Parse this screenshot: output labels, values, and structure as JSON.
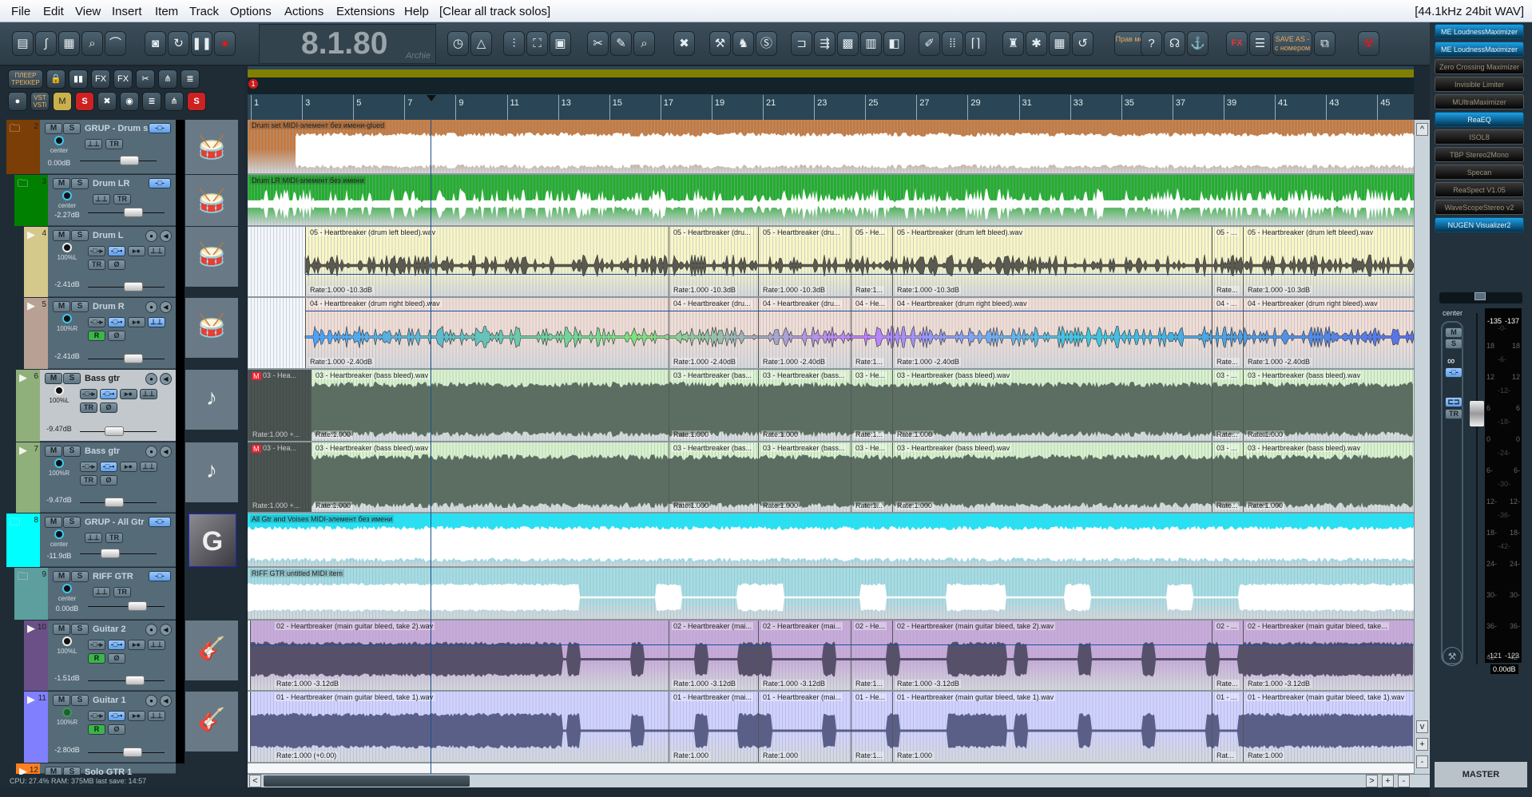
{
  "menu": {
    "items": [
      "File",
      "Edit",
      "View",
      "Insert",
      "Item",
      "Track",
      "Options",
      "Actions",
      "Extensions",
      "Help"
    ],
    "action_hint": "[Clear all track solos]",
    "format_info": "[44.1kHz 24bit WAV]"
  },
  "toolbar": {
    "time_display": "8.1.80",
    "time_user": "Archie",
    "buttons": [
      {
        "icon": "film-icon"
      },
      {
        "icon": "envelope-icon"
      },
      {
        "icon": "color-palette-icon"
      },
      {
        "icon": "find-icon"
      },
      {
        "icon": "curve-icon"
      },
      {
        "icon": "drum-icon"
      },
      {
        "icon": "loop-icon"
      },
      {
        "icon": "pause-icon"
      },
      {
        "icon": "record-icon"
      },
      {
        "icon": "metronome-clock-icon"
      },
      {
        "icon": "metronome-icon"
      },
      {
        "icon": "mixer-icon"
      },
      {
        "icon": "fullscreen-icon"
      },
      {
        "icon": "screen-capture-icon"
      },
      {
        "icon": "split-item-icon"
      },
      {
        "icon": "pencil-icon"
      },
      {
        "icon": "zoom-icon"
      },
      {
        "icon": "delete-track-icon"
      },
      {
        "icon": "wrench-icon"
      },
      {
        "icon": "walkers-icon"
      },
      {
        "icon": "sws-icon"
      },
      {
        "icon": "snap-icon"
      },
      {
        "icon": "ripple-icon"
      },
      {
        "icon": "grid-snap-icon"
      },
      {
        "icon": "color-tracks-icon"
      },
      {
        "icon": "toggle-icon"
      },
      {
        "icon": "brush-icon"
      },
      {
        "icon": "dots-grid-icon"
      },
      {
        "icon": "bracket-icon"
      },
      {
        "icon": "cleanup-icon"
      },
      {
        "icon": "new-folder-icon"
      },
      {
        "icon": "table-icon"
      },
      {
        "icon": "undo-disk-icon"
      },
      {
        "icon": "text-button",
        "label": "Прав меня"
      },
      {
        "icon": "help-icon"
      },
      {
        "icon": "headphones-icon"
      },
      {
        "icon": "anchor-icon"
      },
      {
        "icon": "fx-bypass-icon",
        "label": "FX"
      },
      {
        "icon": "list-icon"
      },
      {
        "icon": "text-button",
        "label": "SAVE AS - с номером"
      },
      {
        "icon": "copy-files-icon"
      },
      {
        "icon": "radiation-icon"
      }
    ]
  },
  "left_toolbar": {
    "row1": [
      {
        "icon": "text-button",
        "label": "ПЛЕЕР ТРЕККЕР"
      },
      {
        "icon": "lock-icon"
      },
      {
        "icon": "show-meters-icon"
      },
      {
        "icon": "fx-remove-icon",
        "label": "FX"
      },
      {
        "icon": "fx-show-icon",
        "label": "FX"
      },
      {
        "icon": "trim-icon"
      },
      {
        "icon": "routing-icon"
      },
      {
        "icon": "track-height-icon"
      }
    ],
    "row2": [
      {
        "icon": "record-circle-icon"
      },
      {
        "icon": "text-button",
        "label": "VST VSTi"
      },
      {
        "icon": "mute-all-icon",
        "label": "M"
      },
      {
        "icon": "solo-all-icon",
        "label": "S"
      },
      {
        "icon": "env-remove-icon"
      },
      {
        "icon": "env-show-icon"
      },
      {
        "icon": "rec-list-icon"
      },
      {
        "icon": "route-tree-icon"
      },
      {
        "icon": "solo-red-icon",
        "label": "S"
      }
    ]
  },
  "ruler": {
    "bars": [
      "1",
      "3",
      "5",
      "7",
      "9",
      "11",
      "13",
      "15",
      "17",
      "19",
      "21",
      "23",
      "25",
      "27",
      "29",
      "31",
      "33",
      "35",
      "37",
      "39",
      "41",
      "43",
      "45"
    ],
    "marker": "1"
  },
  "tracks": [
    {
      "num": "2",
      "name": "GRUP - Drum s",
      "folder": true,
      "pan": "center",
      "vol": "0.00dB",
      "color": "#7a3e06",
      "lane": "#c67a3e",
      "wave": "#ffffff",
      "style": "dense",
      "thumb": "drum-kit-image",
      "items": [
        {
          "label": "Drum set MIDI-элемент без имени-glued",
          "rate": ""
        }
      ]
    },
    {
      "num": "3",
      "name": "Drum LR",
      "folder": true,
      "pan": "center",
      "vol": "-2.27dB",
      "color": "#008000",
      "lane": "#24ad2c",
      "wave": "#ffffff",
      "style": "spiky-white",
      "thumb": "drum-kit-image",
      "items": [
        {
          "label": "Drum LR MIDI-элемент без имени",
          "rate": ""
        }
      ]
    },
    {
      "num": "4",
      "name": "Drum L",
      "pan": "100%L",
      "vol": "-2.41dB",
      "color": "#d4c98a",
      "lane": "#faf6c4",
      "wave": "#5a5a50",
      "style": "spiky",
      "thumb": "drum-kit-image",
      "rec": false,
      "items": [
        {
          "label": "05 - Heartbreaker (drum left bleed).wav",
          "rate": "Rate:1.000 -10.3dB"
        },
        {
          "label": "05 - Heartbreaker (dru...",
          "rate": "Rate:1.000 -10.3dB"
        },
        {
          "label": "05 - Heartbreaker (dru...",
          "rate": "Rate:1.000 -10.3dB"
        },
        {
          "label": "05 - He...",
          "rate": "Rate:1..."
        },
        {
          "label": "05 - Heartbreaker (drum left bleed).wav",
          "rate": "Rate:1.000 -10.3dB"
        },
        {
          "label": "05 - ...",
          "rate": "Rate..."
        },
        {
          "label": "05 - Heartbreaker (drum left bleed).wav",
          "rate": "Rate:1.000 -10.3dB"
        }
      ]
    },
    {
      "num": "5",
      "name": "Drum R",
      "pan": "100%R",
      "vol": "-2.41dB",
      "color": "#b8a194",
      "lane": "#f2ddd3",
      "wave": "#4a78d8",
      "style": "spiky-color",
      "thumb": "drum-kit-image",
      "rec": true,
      "items": [
        {
          "label": "04 - Heartbreaker (drum right bleed).wav",
          "rate": "Rate:1.000 -2.40dB"
        },
        {
          "label": "04 - Heartbreaker (dru...",
          "rate": "Rate:1.000 -2.40dB"
        },
        {
          "label": "04 - Heartbreaker (dru...",
          "rate": "Rate:1.000 -2.40dB"
        },
        {
          "label": "04 - He...",
          "rate": "Rate:1..."
        },
        {
          "label": "04 - Heartbreaker (drum right bleed).wav",
          "rate": "Rate:1.000 -2.40dB"
        },
        {
          "label": "04 - ...",
          "rate": "Rate..."
        },
        {
          "label": "04 - Heartbreaker (drum right bleed).wav",
          "rate": "Rate:1.000 -2.40dB"
        }
      ]
    },
    {
      "num": "6",
      "name": "Bass gtr",
      "pan": "100%L",
      "vol": "-9.47dB",
      "color": "#8fb07a",
      "lane": "#d9f2c9",
      "wave": "#5c6e62",
      "style": "bass",
      "thumb": "bass-guitar-image",
      "rec": false,
      "selected": true,
      "pre_item": {
        "badge": "M",
        "label": "03 - Hea...",
        "rate": "Rate:1.000 +..."
      },
      "items": [
        {
          "label": "03 - Heartbreaker (bass bleed).wav",
          "rate": "Rate:1.000"
        },
        {
          "label": "03 - Heartbreaker (bas...",
          "rate": "Rate:1.000"
        },
        {
          "label": "03 - Heartbreaker (bass...",
          "rate": "Rate:1.000"
        },
        {
          "label": "03 - He...",
          "rate": "Rate:1..."
        },
        {
          "label": "03 - Heartbreaker (bass bleed).wav",
          "rate": "Rate:1.000"
        },
        {
          "label": "03 - ...",
          "rate": "Rate..."
        },
        {
          "label": "03 - Heartbreaker (bass bleed).wav",
          "rate": "Rate:1.000"
        }
      ]
    },
    {
      "num": "7",
      "name": "Bass gtr",
      "pan": "100%R",
      "vol": "-9.47dB",
      "color": "#8fb07a",
      "lane": "#d9f2c9",
      "wave": "#5c6e62",
      "style": "bass",
      "thumb": "bass-guitar-image",
      "rec": false,
      "pre_item": {
        "badge": "M",
        "label": "03 - Hea...",
        "rate": "Rate:1.000 +..."
      },
      "items": [
        {
          "label": "03 - Heartbreaker (bass bleed).wav",
          "rate": "Rate:1.000"
        },
        {
          "label": "03 - Heartbreaker (bas...",
          "rate": "Rate:1.000"
        },
        {
          "label": "03 - Heartbreaker (bass...",
          "rate": "Rate:1.000"
        },
        {
          "label": "03 - He...",
          "rate": "Rate:1..."
        },
        {
          "label": "03 - Heartbreaker (bass bleed).wav",
          "rate": "Rate:1.000"
        },
        {
          "label": "03 - ...",
          "rate": "Rate..."
        },
        {
          "label": "03 - Heartbreaker (bass bleed).wav",
          "rate": "Rate:1.000"
        }
      ]
    },
    {
      "num": "8",
      "name": "GRUP - All Gtr",
      "folder": true,
      "pan": "center",
      "vol": "-11.9dB",
      "color": "#00ffff",
      "lane": "#1ee6f6",
      "wave": "#ffffff",
      "style": "dense",
      "thumb": "G",
      "items": [
        {
          "label": "All Gtr and Voises MIDI-элемент без имени",
          "rate": ""
        }
      ]
    },
    {
      "num": "9",
      "name": "RIFF GTR",
      "folder": true,
      "pan": "center",
      "vol": "0.00dB",
      "color": "#5d9e9e",
      "lane": "#a4dde2",
      "wave": "#ffffff",
      "style": "gappy-white",
      "thumb": "",
      "items": [
        {
          "label": "RIFF GTR untitled MIDI item",
          "rate": ""
        }
      ]
    },
    {
      "num": "10",
      "name": "Guitar 2",
      "pan": "100%L",
      "vol": "-1.51dB",
      "color": "#6b5088",
      "lane": "#caa9d9",
      "wave": "#57506a",
      "style": "guitar",
      "thumb": "electric-guitar-image",
      "rec": true,
      "items": [
        {
          "label": "02 - Heartbreaker (main guitar bleed, take 2).wav",
          "rate": "Rate:1.000 -3.12dB"
        },
        {
          "label": "02 - Heartbreaker (mai...",
          "rate": "Rate:1.000 -3.12dB"
        },
        {
          "label": "02 - Heartbreaker (mai...",
          "rate": "Rate:1.000 -3.12dB"
        },
        {
          "label": "02 - He...",
          "rate": "Rate:1..."
        },
        {
          "label": "02 - Heartbreaker (main guitar bleed, take 2).wav",
          "rate": "Rate:1.000 -3.12dB"
        },
        {
          "label": "02 - ...",
          "rate": "Rate..."
        },
        {
          "label": "02 - Heartbreaker (main guitar bleed, take...",
          "rate": "Rate:1.000 -3.12dB"
        }
      ]
    },
    {
      "num": "11",
      "name": "Guitar 1",
      "pan": "100%R",
      "vol": "-2.80dB",
      "color": "#8080ff",
      "lane": "#d2d2ff",
      "wave": "#5a5f88",
      "style": "guitar",
      "thumb": "les-paul-guitar-image",
      "rec": true,
      "items": [
        {
          "label": "01 - Heartbreaker (main guitar bleed, take 1).wav",
          "rate": "Rate:1.000 (+0.00)"
        },
        {
          "label": "01 - Heartbreaker (mai...",
          "rate": "Rate:1.000"
        },
        {
          "label": "01 - Heartbreaker (mai...",
          "rate": "Rate:1.000"
        },
        {
          "label": "01 - He...",
          "rate": "Rate:1..."
        },
        {
          "label": "01 - Heartbreaker (main guitar bleed, take 1).wav",
          "rate": "Rate:1.000"
        },
        {
          "label": "01 - ...",
          "rate": "Rat..."
        },
        {
          "label": "01 - Heartbreaker (main guitar bleed, take 1).wav",
          "rate": "Rate:1.000"
        }
      ]
    },
    {
      "num": "12",
      "name": "Solo GTR 1",
      "pan": "",
      "vol": "",
      "color": "#ff7f1e",
      "lane": "#f4f6f8",
      "wave": "#888",
      "style": "none",
      "thumb": "",
      "items": []
    }
  ],
  "status": "CPU: 27.4%  RAM: 375MB  last save: 14:57",
  "fx_chain": [
    {
      "name": "ME LoudnessMaximizer",
      "active": true
    },
    {
      "name": "ME LoudnessMaximizer",
      "active": true
    },
    {
      "name": "Zero Crossing Maximizer",
      "active": false
    },
    {
      "name": "Invisible Limiter",
      "active": false
    },
    {
      "name": "MUltraMaximizer",
      "active": false
    },
    {
      "name": "ReaEQ",
      "active": true
    },
    {
      "name": "ISOL8",
      "active": false
    },
    {
      "name": "TBP Stereo2Mono",
      "active": false
    },
    {
      "name": "Specan",
      "active": false
    },
    {
      "name": "ReaSpect V1.05",
      "active": false
    },
    {
      "name": "WaveScopeStereo v2",
      "active": false
    },
    {
      "name": "NUGEN Visualizer2",
      "active": true
    }
  ],
  "master": {
    "label": "MASTER",
    "pan": "center",
    "volume": "0.00dB",
    "mute": "M",
    "solo": "S",
    "link": "∞",
    "trim": "TR",
    "peak_l": "-135",
    "peak_r": "-137",
    "bottom_l": "-121",
    "bottom_r": "-123",
    "scale_left": [
      "18",
      "12",
      "6",
      "0",
      "6-",
      "12-",
      "18-",
      "24-",
      "30-",
      "36-",
      "42-"
    ],
    "scale_mid": [
      "-0-",
      "-6-",
      "-12-",
      "-18-",
      "-24-",
      "-30-",
      "-36-",
      "-42-"
    ]
  },
  "scroll": {
    "up": "^",
    "down": "v",
    "zoom_in": "+",
    "zoom_out": "-",
    "left": "<",
    "right": ">"
  }
}
